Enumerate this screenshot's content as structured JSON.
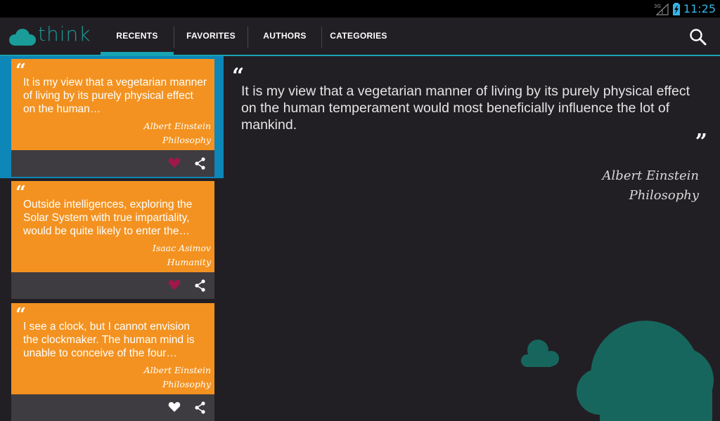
{
  "status_bar": {
    "network": "3G",
    "time": "11:25"
  },
  "app": {
    "logo_text": "think"
  },
  "tabs": [
    {
      "label": "RECENTS",
      "active": true
    },
    {
      "label": "FAVORITES",
      "active": false
    },
    {
      "label": "AUTHORS",
      "active": false
    },
    {
      "label": "CATEGORIES",
      "active": false
    }
  ],
  "quotes": [
    {
      "text": "It is my view that a vegetarian manner of living by its purely physical effect on the human…",
      "author": "Albert Einstein",
      "category": "Philosophy",
      "favorite": true,
      "selected": true
    },
    {
      "text": "Outside intelligences, exploring the Solar System with true impartiality, would be quite likely to enter the…",
      "author": "Isaac Asimov",
      "category": "Humanity",
      "favorite": true,
      "selected": false
    },
    {
      "text": "I see a clock, but I cannot envision the clockmaker. The human mind is unable to conceive of the four…",
      "author": "Albert Einstein",
      "category": "Philosophy",
      "favorite": false,
      "selected": false
    }
  ],
  "detail": {
    "text": "It is my view that a vegetarian manner of living by its purely physical effect on the human temperament would most beneficially influence the lot of mankind.",
    "author": "Albert Einstein",
    "category": "Philosophy"
  },
  "colors": {
    "accent": "#18a4b3",
    "card": "#f39220",
    "favorite_heart": "#a0174a",
    "plain_heart": "#ffffff",
    "cloud": "#17665e"
  },
  "icons": {
    "search": "search-icon",
    "heart": "heart-icon",
    "share": "share-icon",
    "signal": "signal-icon",
    "battery": "battery-icon"
  }
}
